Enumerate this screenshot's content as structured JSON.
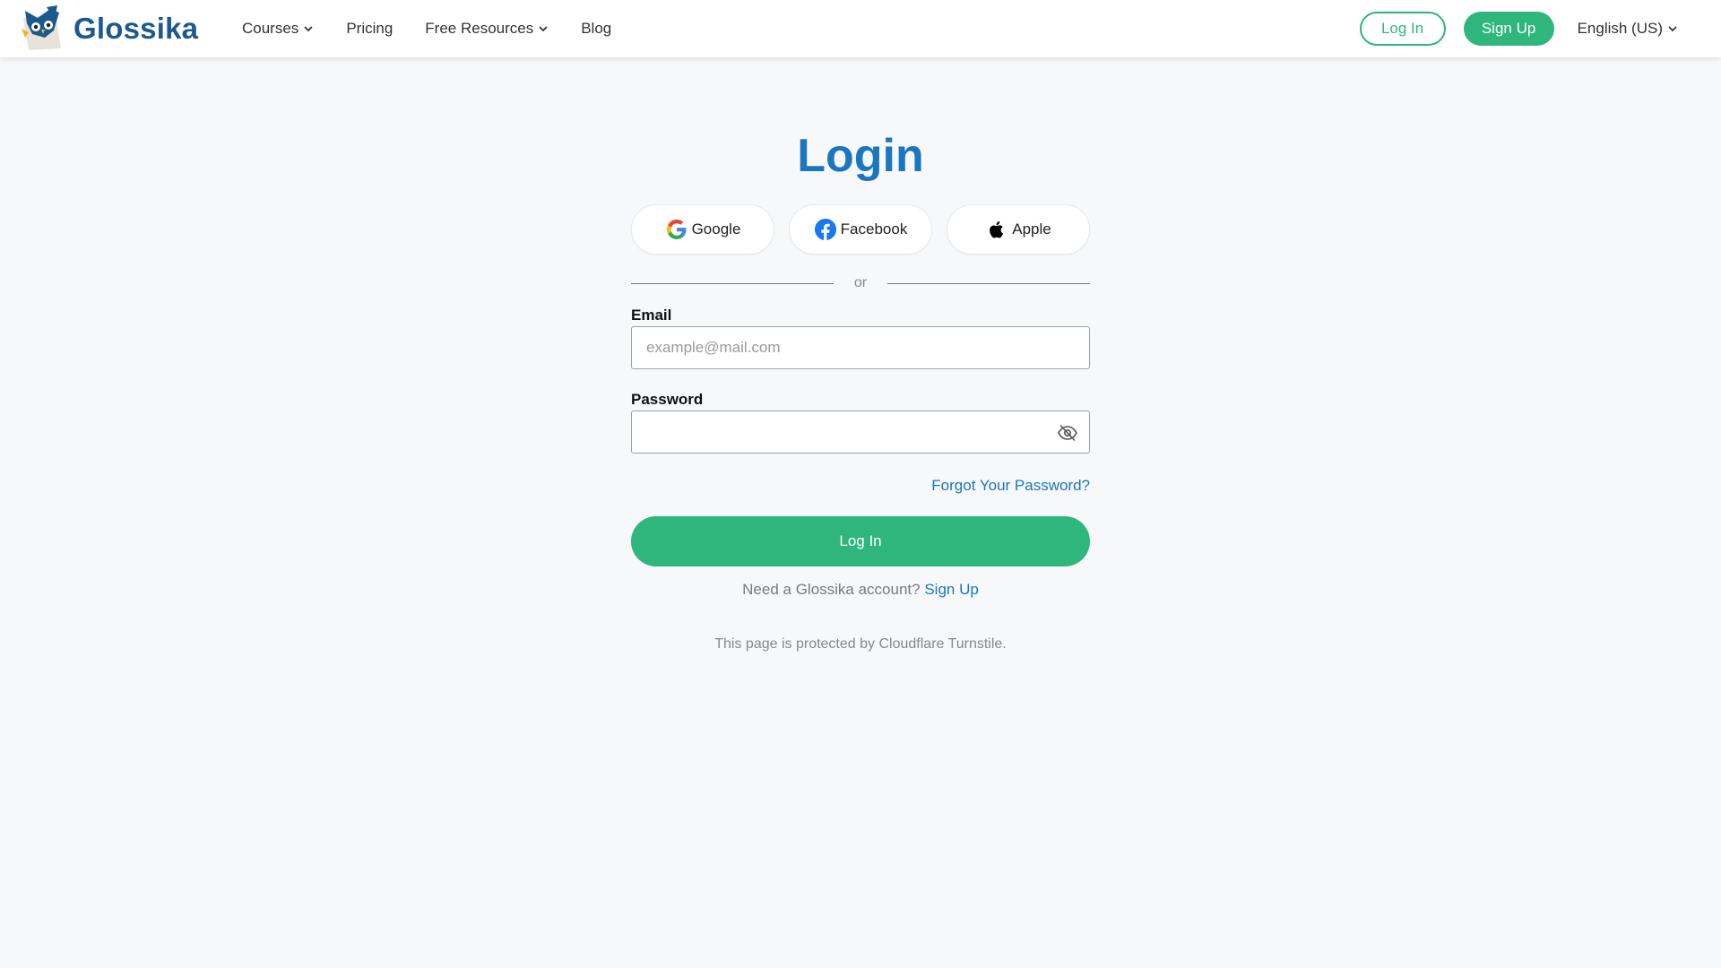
{
  "brand": {
    "name": "Glossika"
  },
  "nav": {
    "items": [
      {
        "label": "Courses",
        "dropdown": true
      },
      {
        "label": "Pricing",
        "dropdown": false
      },
      {
        "label": "Free Resources",
        "dropdown": true
      },
      {
        "label": "Blog",
        "dropdown": false
      }
    ],
    "login_label": "Log In",
    "signup_label": "Sign Up",
    "language": "English (US)"
  },
  "login": {
    "title": "Login",
    "social": [
      {
        "label": "Google",
        "icon": "google-icon"
      },
      {
        "label": "Facebook",
        "icon": "facebook-icon"
      },
      {
        "label": "Apple",
        "icon": "apple-icon"
      }
    ],
    "divider_text": "or",
    "email_label": "Email",
    "email_placeholder": "example@mail.com",
    "email_value": "",
    "password_label": "Password",
    "password_value": "",
    "forgot_label": "Forgot Your Password?",
    "submit_label": "Log In",
    "need_account_text": "Need a Glossika account?",
    "signup_link": "Sign Up",
    "protected_text": "This page is protected by Cloudflare Turnstile."
  },
  "colors": {
    "accent_green": "#2eb67d",
    "title_blue": "#1b76c0",
    "logo_blue": "#1c5a8e",
    "page_bg": "#f7f8fa"
  }
}
